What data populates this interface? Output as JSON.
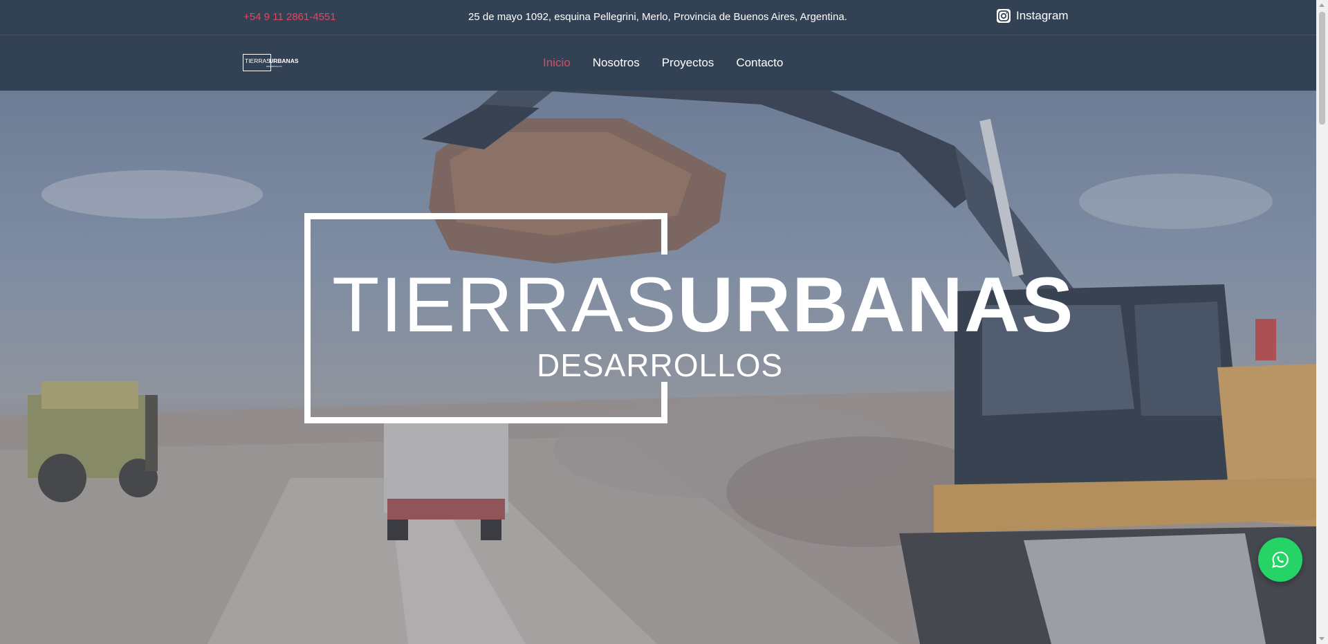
{
  "topbar": {
    "phone": "+54 9 11 2861-4551",
    "address": "25 de mayo 1092, esquina Pellegrini, Merlo, Provincia de Buenos Aires, Argentina.",
    "instagram_label": "Instagram",
    "instagram_icon": "instagram-icon"
  },
  "nav": {
    "logo_light": "TIERRAS",
    "logo_bold": "URBANAS",
    "logo_sub": "DESARROLLOS",
    "links": [
      {
        "label": "Inicio",
        "active": true
      },
      {
        "label": "Nosotros",
        "active": false
      },
      {
        "label": "Proyectos",
        "active": false
      },
      {
        "label": "Contacto",
        "active": false
      }
    ]
  },
  "hero": {
    "brand_light": "TIERRAS",
    "brand_bold": "URBANAS",
    "brand_sub": "DESARROLLOS"
  },
  "floating": {
    "whatsapp_icon": "whatsapp-icon"
  },
  "colors": {
    "bar_bg": "#334155",
    "accent": "#e0485f",
    "whatsapp": "#25d366"
  }
}
